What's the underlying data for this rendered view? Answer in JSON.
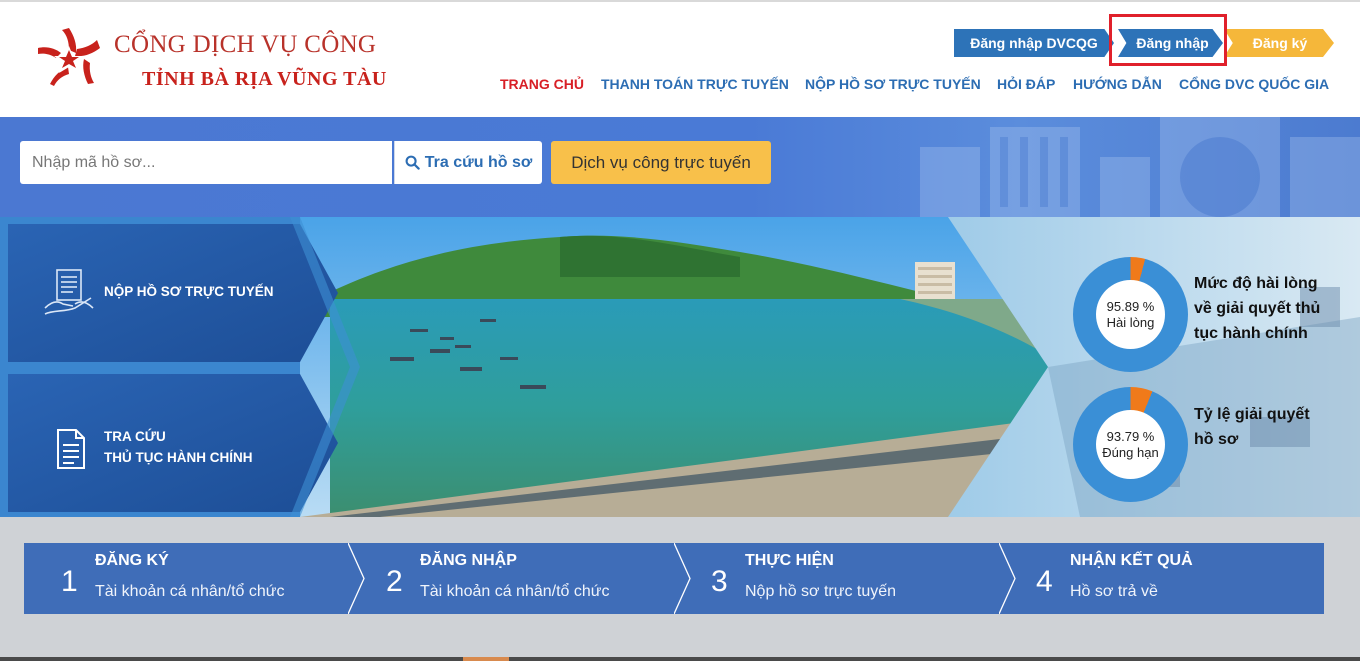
{
  "brand": {
    "title": "CỔNG DỊCH VỤ CÔNG",
    "subtitle": "TỈNH BÀ RỊA VŨNG TÀU",
    "logo_icon": "star-ribbon-logo-icon",
    "colors": {
      "primary": "#2d73b8",
      "brand_red": "#c8221c",
      "accent": "#f5b73a"
    }
  },
  "auth": {
    "dvcqg_label": "Đăng nhập DVCQG",
    "login_label": "Đăng nhập",
    "register_label": "Đăng ký"
  },
  "nav": {
    "items": [
      {
        "label": "TRANG CHỦ",
        "active": true
      },
      {
        "label": "THANH TOÁN TRỰC TUYẾN"
      },
      {
        "label": "NỘP HỒ SƠ TRỰC TUYẾN"
      },
      {
        "label": "HỎI ĐÁP"
      },
      {
        "label": "HƯỚNG DẪN"
      },
      {
        "label": "CỔNG DVC QUỐC GIA"
      }
    ]
  },
  "search": {
    "placeholder": "Nhập mã hồ sơ...",
    "button_label": "Tra cứu hồ sơ",
    "button_icon": "search-icon",
    "dvc_button_label": "Dịch vụ công trực tuyến"
  },
  "tiles": [
    {
      "line1": "NỘP HỒ SƠ TRỰC TUYẾN",
      "icon": "document-hand-icon"
    },
    {
      "line1": "TRA CỨU",
      "line2": "THỦ TỤC HÀNH CHÍNH",
      "icon": "document-list-icon"
    }
  ],
  "stats": {
    "satisfaction": {
      "percent_text": "95.89 %",
      "label": "Hài lòng",
      "value": 95.89,
      "title": "Mức độ hài lòng về giải quyết thủ tục hành chính"
    },
    "ontime": {
      "percent_text": "93.79 %",
      "label": "Đúng hạn",
      "value": 93.79,
      "title": "Tỷ lệ giải quyết hồ sơ"
    },
    "colors": {
      "filled": "#3a8fd6",
      "remaining": "#f07a1a"
    }
  },
  "steps": [
    {
      "number": "1",
      "title": "ĐĂNG KÝ",
      "desc": "Tài khoản cá nhân/tổ chức"
    },
    {
      "number": "2",
      "title": "ĐĂNG NHẬP",
      "desc": "Tài khoản cá nhân/tổ chức"
    },
    {
      "number": "3",
      "title": "THỰC HIỆN",
      "desc": "Nộp hồ sơ trực tuyến"
    },
    {
      "number": "4",
      "title": "NHẬN KẾT QUẢ",
      "desc": "Hồ sơ trả về"
    }
  ]
}
